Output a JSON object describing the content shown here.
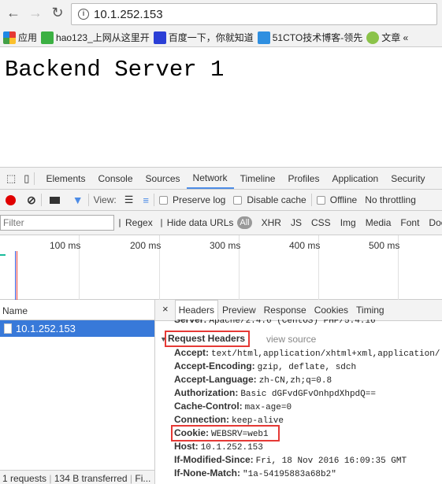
{
  "browser": {
    "url": "10.1.252.153",
    "bookmarks": [
      {
        "label": "应用",
        "color": "#e53935"
      },
      {
        "label": "hao123_上网从这里开",
        "color": "#3cb043"
      },
      {
        "label": "百度一下，你就知道",
        "color": "#2b3fd6"
      },
      {
        "label": "51CTO技术博客-领先",
        "color": "#2f8fe0"
      },
      {
        "label": "文章 «",
        "color": "#8bc34a"
      }
    ]
  },
  "page": {
    "heading": "Backend Server 1"
  },
  "devtools": {
    "tabs": [
      "Elements",
      "Console",
      "Sources",
      "Network",
      "Timeline",
      "Profiles",
      "Application",
      "Security"
    ],
    "active_tab": "Network",
    "toolbar": {
      "view_label": "View:",
      "preserve_log": "Preserve log",
      "disable_cache": "Disable cache",
      "offline": "Offline",
      "throttling": "No throttling"
    },
    "filter": {
      "placeholder": "Filter",
      "regex": "Regex",
      "hide_data_urls": "Hide data URLs",
      "types": [
        "All",
        "XHR",
        "JS",
        "CSS",
        "Img",
        "Media",
        "Font",
        "Doc"
      ]
    },
    "timeline": {
      "ticks": [
        "100 ms",
        "200 ms",
        "300 ms",
        "400 ms",
        "500 ms"
      ]
    },
    "requests": {
      "column": "Name",
      "items": [
        "10.1.252.153"
      ]
    },
    "footer": {
      "requests": "1 requests",
      "transferred": "134 B transferred",
      "finish": "Fi..."
    },
    "detail": {
      "tabs": [
        "Headers",
        "Preview",
        "Response",
        "Cookies",
        "Timing"
      ],
      "active_tab": "Headers",
      "server_line": {
        "name": "Server:",
        "value": "Apache/2.4.6 (CentOS) PHP/5.4.16"
      },
      "section": "Request Headers",
      "view_source": "view source",
      "headers": [
        {
          "name": "Accept:",
          "value": "text/html,application/xhtml+xml,application/"
        },
        {
          "name": "Accept-Encoding:",
          "value": "gzip, deflate, sdch"
        },
        {
          "name": "Accept-Language:",
          "value": "zh-CN,zh;q=0.8"
        },
        {
          "name": "Authorization:",
          "value": "Basic dGFvdGFvOnhpdXhpdQ=="
        },
        {
          "name": "Cache-Control:",
          "value": "max-age=0"
        },
        {
          "name": "Connection:",
          "value": "keep-alive"
        },
        {
          "name": "Cookie:",
          "value": "WEBSRV=web1"
        },
        {
          "name": "Host:",
          "value": "10.1.252.153"
        },
        {
          "name": "If-Modified-Since:",
          "value": "Fri, 18 Nov 2016 16:09:35 GMT"
        },
        {
          "name": "If-None-Match:",
          "value": "\"1a-54195883a68b2\""
        }
      ]
    }
  },
  "colors": {
    "accent": "#4d8ce6",
    "selection": "#3879d9",
    "highlight_box": "#e53935",
    "record": "#e00000"
  }
}
